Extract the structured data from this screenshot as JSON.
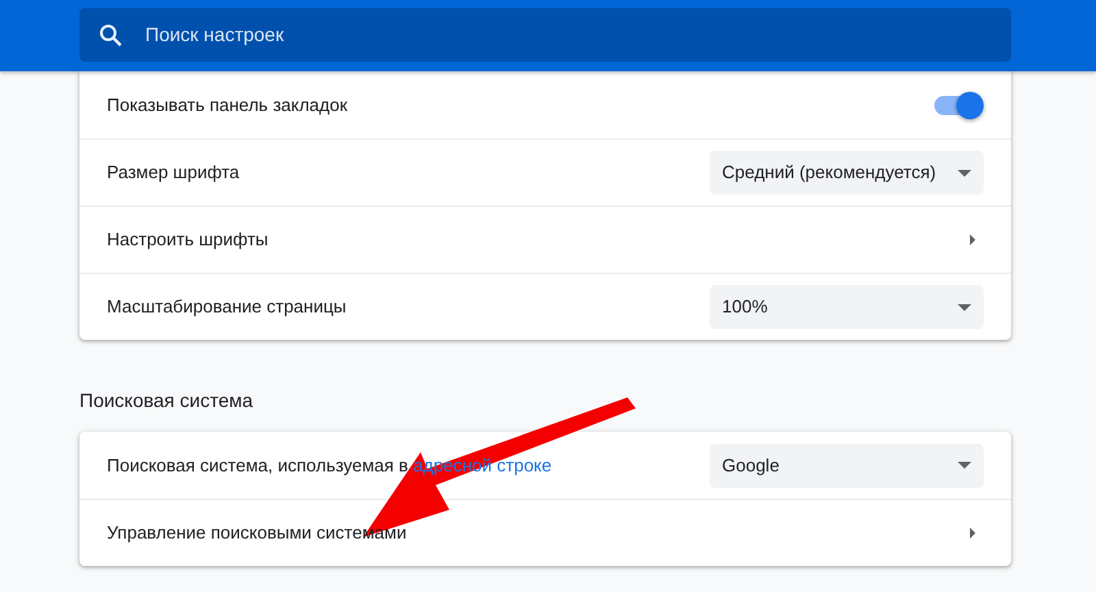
{
  "search": {
    "placeholder": "Поиск настроек"
  },
  "appearance": {
    "rows": [
      {
        "kind": "toggle",
        "label": "Показывать панель закладок",
        "on": true
      },
      {
        "kind": "select",
        "label": "Размер шрифта",
        "value": "Средний (рекомендуется)"
      },
      {
        "kind": "submenu",
        "label": "Настроить шрифты"
      },
      {
        "kind": "select",
        "label": "Масштабирование страницы",
        "value": "100%"
      }
    ]
  },
  "search_engine": {
    "title": "Поисковая система",
    "rows": [
      {
        "kind": "select",
        "label": "Поисковая система, используемая в ",
        "link": "адресной строке",
        "value": "Google"
      },
      {
        "kind": "submenu",
        "label": "Управление поисковыми системами"
      }
    ]
  }
}
